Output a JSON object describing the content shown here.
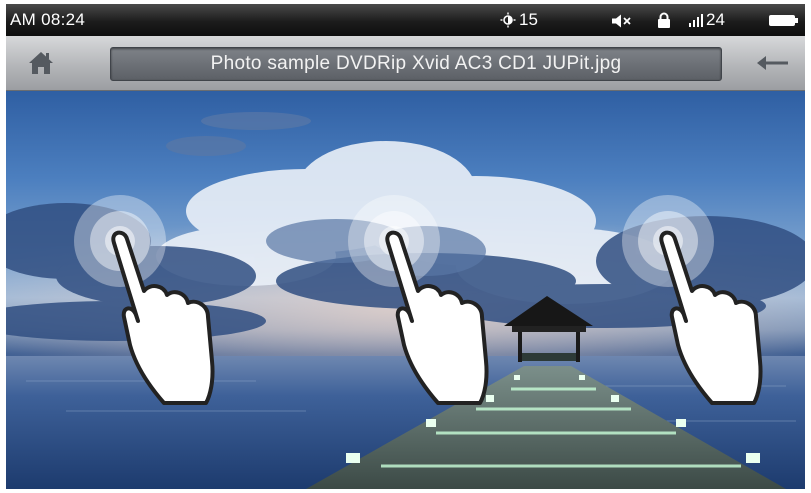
{
  "status": {
    "time": "AM 08:24",
    "brightness": "15",
    "signal": "24",
    "icons": [
      "brightness-icon",
      "mute-icon",
      "lock-icon",
      "signal-icon",
      "battery-icon"
    ]
  },
  "header": {
    "title": "Photo sample DVDRip Xvid AC3 CD1 JUPit.jpg",
    "icons": [
      "home-icon",
      "back-arrow-icon"
    ]
  },
  "viewer": {
    "image": "sunset sky over pier with hut",
    "gesture_icons": [
      "tap-gesture-hand-icon",
      "tap-gesture-hand-icon",
      "tap-gesture-hand-icon"
    ]
  },
  "colors": {
    "statusbar": "#1c1c1c",
    "titlebar": "#b1b3b6",
    "titlebox": "#5c6066"
  }
}
